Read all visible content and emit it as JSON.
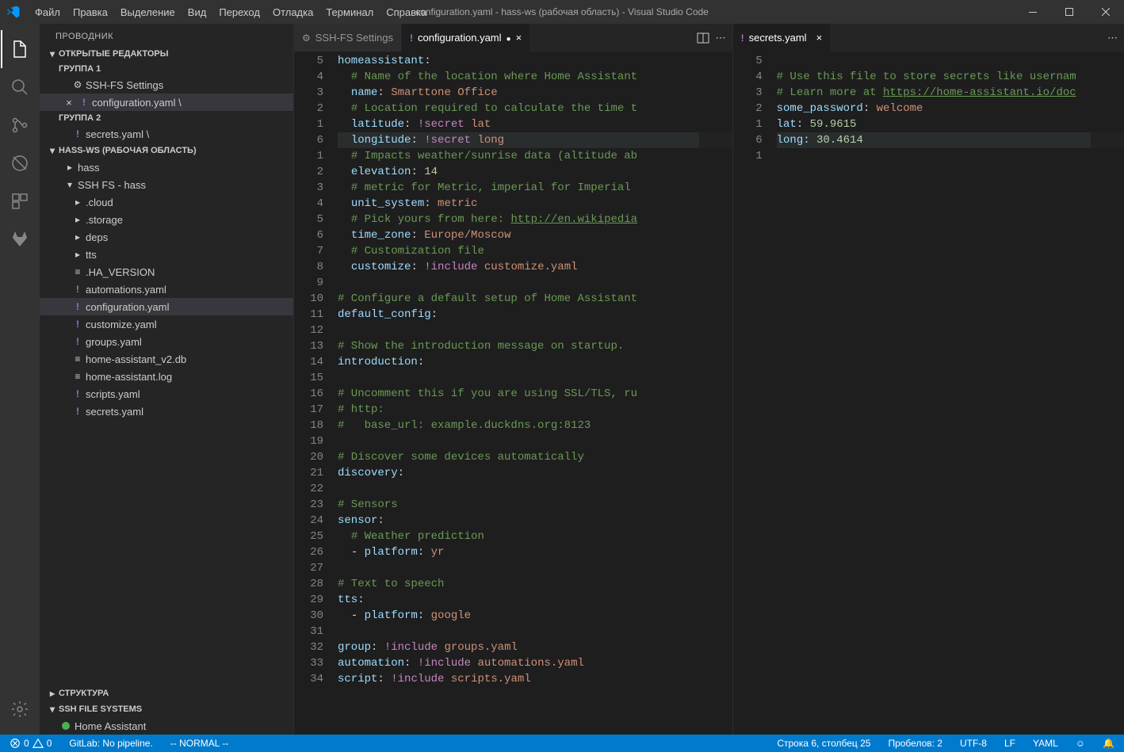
{
  "window": {
    "title": "configuration.yaml - hass-ws (рабочая область) - Visual Studio Code"
  },
  "menu": [
    "Файл",
    "Правка",
    "Выделение",
    "Вид",
    "Переход",
    "Отладка",
    "Терминал",
    "Справка"
  ],
  "sidebar": {
    "title": "ПРОВОДНИК",
    "open_editors": "ОТКРЫТЫЕ РЕДАКТОРЫ",
    "group1": "ГРУППА 1",
    "group2": "ГРУППА 2",
    "oe": [
      {
        "label": "SSH-FS Settings",
        "icon": "gear"
      },
      {
        "label": "configuration.yaml \\",
        "icon": "yaml",
        "dirty": true
      },
      {
        "label": "secrets.yaml \\",
        "icon": "yaml"
      }
    ],
    "ws_label": "HASS-WS (РАБОЧАЯ ОБЛАСТЬ)",
    "tree": {
      "hass": "hass",
      "sshfs": "SSH FS - hass",
      "items": [
        ".cloud",
        ".storage",
        "deps",
        "tts",
        ".HA_VERSION",
        "automations.yaml",
        "configuration.yaml",
        "customize.yaml",
        "groups.yaml",
        "home-assistant_v2.db",
        "home-assistant.log",
        "scripts.yaml",
        "secrets.yaml"
      ]
    },
    "outline": "СТРУКТУРА",
    "sshfs_section": "SSH FILE SYSTEMS",
    "sshfs_item": "Home Assistant"
  },
  "tabs1": [
    {
      "label": "SSH-FS Settings",
      "type": "gear"
    },
    {
      "label": "configuration.yaml",
      "type": "yaml",
      "active": true,
      "dirty": true
    }
  ],
  "tabs2": [
    {
      "label": "secrets.yaml",
      "type": "yaml",
      "active": true
    }
  ],
  "editor1": {
    "gutter": [
      "5",
      "4",
      "3",
      "2",
      "1",
      "6",
      "1",
      "2",
      "3",
      "4",
      "5",
      "6",
      "7",
      "8",
      "9",
      "10",
      "11",
      "12",
      "13",
      "14",
      "15",
      "16",
      "17",
      "18",
      "19",
      "20",
      "21",
      "22",
      "23",
      "24",
      "25",
      "26",
      "27",
      "28",
      "29",
      "30",
      "31",
      "32",
      "33",
      "34"
    ],
    "lines": [
      {
        "t": "key",
        "html": "<span class='k'>homeassistant</span><span class='p'>:</span>"
      },
      {
        "t": "cm",
        "html": "  <span class='c'># Name of the location where Home Assistant</span>"
      },
      {
        "t": "kv",
        "html": "  <span class='k'>name</span><span class='p'>: </span><span class='s'>Smarttone Office</span>"
      },
      {
        "t": "cm",
        "html": "  <span class='c'># Location required to calculate the time t</span>"
      },
      {
        "t": "kv",
        "html": "  <span class='k'>latitude</span><span class='p'>: </span><span class='t'>!secret</span> <span class='s'>lat</span>"
      },
      {
        "t": "hl",
        "html": "  <span class='k'>longitude</span><span class='p'>: </span><span class='t'>!secret</span> <span class='s'>long</span>"
      },
      {
        "t": "cm",
        "html": "  <span class='c'># Impacts weather/sunrise data (altitude ab</span>"
      },
      {
        "t": "kv",
        "html": "  <span class='k'>elevation</span><span class='p'>: </span><span class='n'>14</span>"
      },
      {
        "t": "cm",
        "html": "  <span class='c'># metric for Metric, imperial for Imperial</span>"
      },
      {
        "t": "kv",
        "html": "  <span class='k'>unit_system</span><span class='p'>: </span><span class='s'>metric</span>"
      },
      {
        "t": "cm",
        "html": "  <span class='c'># Pick yours from here: </span><span class='c link'>http://en.wikipedia</span>"
      },
      {
        "t": "kv",
        "html": "  <span class='k'>time_zone</span><span class='p'>: </span><span class='s'>Europe/Moscow</span>"
      },
      {
        "t": "cm",
        "html": "  <span class='c'># Customization file</span>"
      },
      {
        "t": "kv",
        "html": "  <span class='k'>customize</span><span class='p'>: </span><span class='t'>!include</span> <span class='s'>customize.yaml</span>"
      },
      {
        "t": "bl",
        "html": " "
      },
      {
        "t": "cm",
        "html": "<span class='c'># Configure a default setup of Home Assistant</span>"
      },
      {
        "t": "key",
        "html": "<span class='k'>default_config</span><span class='p'>:</span>"
      },
      {
        "t": "bl",
        "html": " "
      },
      {
        "t": "cm",
        "html": "<span class='c'># Show the introduction message on startup.</span>"
      },
      {
        "t": "key",
        "html": "<span class='k'>introduction</span><span class='p'>:</span>"
      },
      {
        "t": "bl",
        "html": " "
      },
      {
        "t": "cm",
        "html": "<span class='c'># Uncomment this if you are using SSL/TLS, ru</span>"
      },
      {
        "t": "cm",
        "html": "<span class='c'># http:</span>"
      },
      {
        "t": "cm",
        "html": "<span class='c'>#   base_url: example.duckdns.org:8123</span>"
      },
      {
        "t": "bl",
        "html": " "
      },
      {
        "t": "cm",
        "html": "<span class='c'># Discover some devices automatically</span>"
      },
      {
        "t": "key",
        "html": "<span class='k'>discovery</span><span class='p'>:</span>"
      },
      {
        "t": "bl",
        "html": " "
      },
      {
        "t": "cm",
        "html": "<span class='c'># Sensors</span>"
      },
      {
        "t": "key",
        "html": "<span class='k'>sensor</span><span class='p'>:</span>"
      },
      {
        "t": "cm",
        "html": "  <span class='c'># Weather prediction</span>"
      },
      {
        "t": "kv",
        "html": "  <span class='p'>- </span><span class='k'>platform</span><span class='p'>: </span><span class='s'>yr</span>"
      },
      {
        "t": "bl",
        "html": " "
      },
      {
        "t": "cm",
        "html": "<span class='c'># Text to speech</span>"
      },
      {
        "t": "key",
        "html": "<span class='k'>tts</span><span class='p'>:</span>"
      },
      {
        "t": "kv",
        "html": "  <span class='p'>- </span><span class='k'>platform</span><span class='p'>: </span><span class='s'>google</span>"
      },
      {
        "t": "bl",
        "html": " "
      },
      {
        "t": "kv",
        "html": "<span class='k'>group</span><span class='p'>: </span><span class='t'>!include</span> <span class='s'>groups.yaml</span>"
      },
      {
        "t": "kv",
        "html": "<span class='k'>automation</span><span class='p'>: </span><span class='t'>!include</span> <span class='s'>automations.yaml</span>"
      },
      {
        "t": "kv",
        "html": "<span class='k'>script</span><span class='p'>: </span><span class='t'>!include</span> <span class='s'>scripts.yaml</span>"
      }
    ]
  },
  "editor2": {
    "gutter": [
      "5",
      "4",
      "3",
      "2",
      "1",
      "6",
      "1"
    ],
    "lines": [
      {
        "html": " "
      },
      {
        "html": "<span class='c'># Use this file to store secrets like usernam</span>"
      },
      {
        "html": "<span class='c'># Learn more at </span><span class='c link'>https://home-assistant.io/doc</span>"
      },
      {
        "html": "<span class='k'>some_password</span><span class='p'>: </span><span class='s'>welcome</span>"
      },
      {
        "html": "<span class='k'>lat</span><span class='p'>: </span><span class='n'>59.9615</span>"
      },
      {
        "hl": true,
        "html": "<span class='k'>long</span><span class='p'>: </span><span class='n'>30.4614</span>"
      },
      {
        "html": " "
      }
    ]
  },
  "status": {
    "errors": "0",
    "warnings": "0",
    "gitlab": "GitLab: No pipeline.",
    "mode": "-- NORMAL --",
    "pos": "Строка 6, столбец 25",
    "spaces": "Пробелов: 2",
    "enc": "UTF-8",
    "eol": "LF",
    "lang": "YAML"
  }
}
